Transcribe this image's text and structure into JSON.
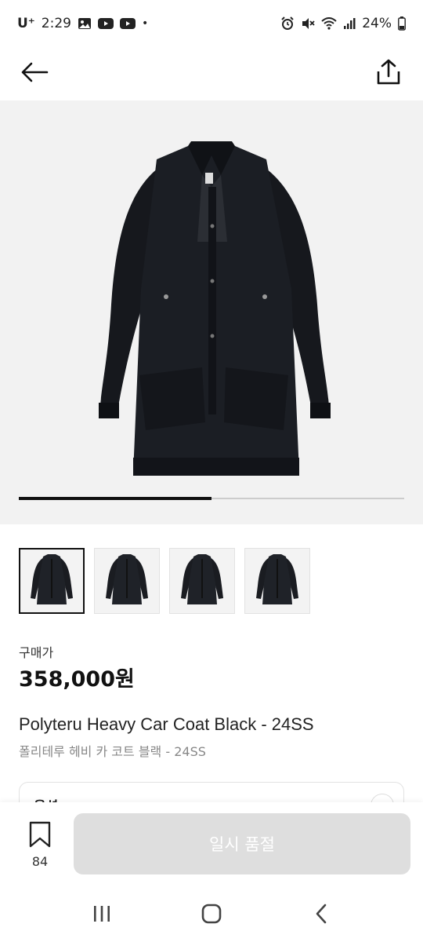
{
  "status_bar": {
    "carrier": "U⁺",
    "time": "2:29",
    "dot": "•",
    "battery_percent": "24%",
    "left_icons": [
      "image-icon",
      "youtube-icon",
      "youtube-icon"
    ],
    "right_icons": [
      "alarm-icon",
      "mute-icon",
      "wifi-icon",
      "signal-icon",
      "battery-icon"
    ]
  },
  "nav": {
    "back_icon": "arrow-left-icon",
    "share_icon": "share-icon"
  },
  "carousel": {
    "image_description_icon": "coat-image",
    "progress": 0.5
  },
  "thumbnails": [
    {
      "icon": "coat-thumbnail",
      "active": true
    },
    {
      "icon": "coat-thumbnail",
      "active": false
    },
    {
      "icon": "coat-thumbnail",
      "active": false
    },
    {
      "icon": "coat-thumbnail",
      "active": false
    }
  ],
  "product": {
    "price_label": "구매가",
    "price": "358,000원",
    "name_en": "Polyteru Heavy Car Coat Black - 24SS",
    "name_ko": "폴리테루 헤비 카 코트 블랙 - 24SS"
  },
  "option": {
    "label": "옵션"
  },
  "bottom_bar": {
    "bookmark_count": "84",
    "buy_button_label": "일시 품절"
  },
  "colors": {
    "accent": "#111111",
    "disabled_button": "#dedede",
    "background": "#f2f2f2"
  }
}
